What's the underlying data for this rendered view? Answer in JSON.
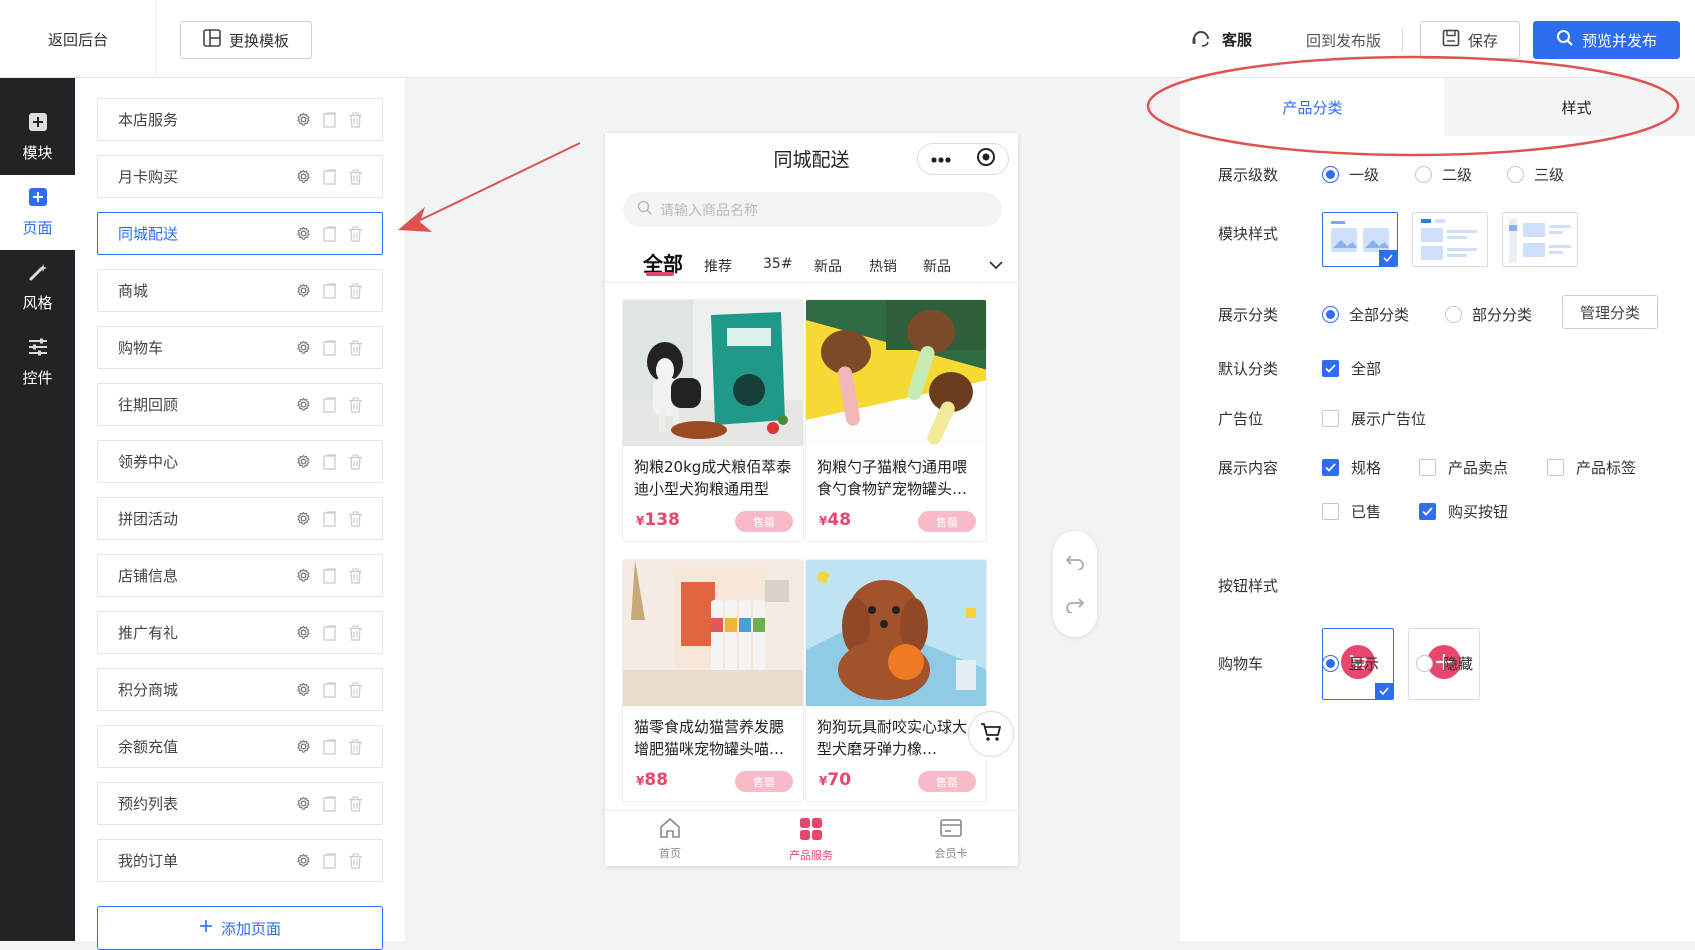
{
  "topbar": {
    "back_label": "返回后台",
    "template_label": "更换模板",
    "service_label": "客服",
    "revert_label": "回到发布版",
    "save_label": "保存",
    "publish_label": "预览并发布"
  },
  "sidebar": {
    "items": [
      {
        "label": "模块",
        "icon": "plus-square-icon"
      },
      {
        "label": "页面",
        "icon": "plus-square-icon"
      },
      {
        "label": "风格",
        "icon": "magic-wand-icon"
      },
      {
        "label": "控件",
        "icon": "sliders-icon"
      }
    ],
    "active": "页面"
  },
  "pages": {
    "items": [
      "本店服务",
      "月卡购买",
      "同城配送",
      "商城",
      "购物车",
      "往期回顾",
      "领券中心",
      "拼团活动",
      "店铺信息",
      "推广有礼",
      "积分商城",
      "余额充值",
      "预约列表",
      "我的订单"
    ],
    "active": "同城配送",
    "add_label": "添加页面"
  },
  "phone": {
    "title": "同城配送",
    "search_placeholder": "请输入商品名称",
    "tabs": [
      "全部",
      "推荐",
      "35#",
      "新品",
      "热销",
      "新品"
    ],
    "products": [
      {
        "name": "狗粮20kg成犬粮佰萃泰迪小型犬狗粮通用型",
        "currency": "¥",
        "price": "138",
        "sold": "售罄"
      },
      {
        "name": "狗粮勺子猫粮勺通用喂食勺食物铲宠物罐头…",
        "currency": "¥",
        "price": "48",
        "sold": "售罄"
      },
      {
        "name": "猫零食成幼猫营养发腮增肥猫咪宠物罐头喵…",
        "currency": "¥",
        "price": "88",
        "sold": "售罄"
      },
      {
        "name": "狗狗玩具耐咬实心球大型犬磨牙弹力橡…",
        "currency": "¥",
        "price": "70",
        "sold": "售罄"
      }
    ],
    "tabbar": [
      {
        "label": "首页",
        "icon": "home-icon"
      },
      {
        "label": "产品服务",
        "icon": "grid-icon"
      },
      {
        "label": "会员卡",
        "icon": "card-icon"
      }
    ]
  },
  "panel": {
    "tabs": [
      "产品分类",
      "样式"
    ],
    "level_label": "展示级数",
    "level_options": [
      "一级",
      "二级",
      "三级"
    ],
    "level_selected": "一级",
    "module_style_label": "模块样式",
    "show_cat_label": "展示分类",
    "show_cat_options": [
      "全部分类",
      "部分分类"
    ],
    "show_cat_selected": "全部分类",
    "manage_label": "管理分类",
    "default_cat_label": "默认分类",
    "default_cat_value": "全部",
    "ad_label": "广告位",
    "ad_option": "展示广告位",
    "content_label": "展示内容",
    "content_options": [
      {
        "label": "规格",
        "checked": true
      },
      {
        "label": "产品卖点",
        "checked": false
      },
      {
        "label": "产品标签",
        "checked": false
      },
      {
        "label": "已售",
        "checked": false
      },
      {
        "label": "购买按钮",
        "checked": true
      }
    ],
    "button_style_label": "按钮样式",
    "cart_label": "购物车",
    "cart_options": [
      "显示",
      "隐藏"
    ],
    "cart_selected": "显示"
  },
  "colors": {
    "accent": "#2e6cf0",
    "pink": "#e8466e",
    "annotation": "#e05252"
  }
}
